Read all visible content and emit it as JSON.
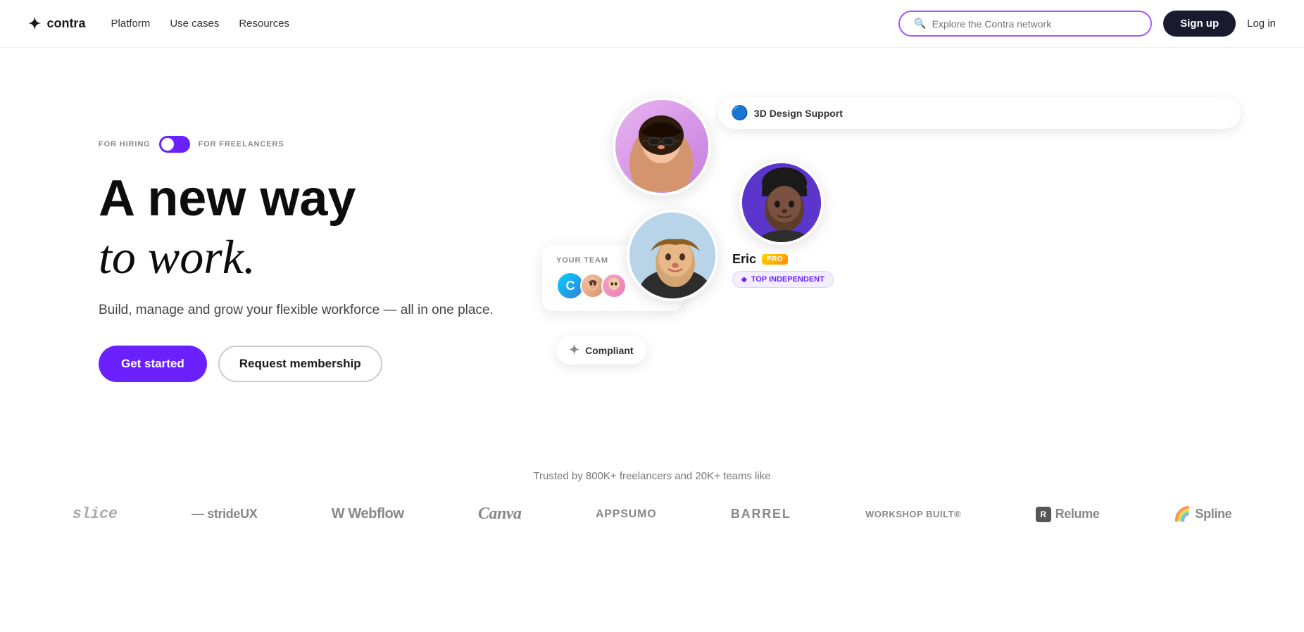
{
  "nav": {
    "logo_text": "contra",
    "links": [
      "Platform",
      "Use cases",
      "Resources"
    ],
    "search_placeholder": "Explore the Contra network",
    "signup_label": "Sign up",
    "login_label": "Log in"
  },
  "hero": {
    "toggle_left": "FOR HIRING",
    "toggle_right": "FOR FREELANCERS",
    "title_line1": "A new way",
    "title_line2": "to work.",
    "description": "Build, manage and grow your flexible workforce — all in one place.",
    "btn_get_started": "Get started",
    "btn_request": "Request membership"
  },
  "floating": {
    "design_badge": "3D Design Support",
    "your_team_label": "YOUR TEAM",
    "compliant_label": "Compliant",
    "eric_name": "Eric",
    "pro_label": "PRO",
    "top_independent": "TOP INDEPENDENT"
  },
  "trusted": {
    "text": "Trusted by 800K+ freelancers and 20K+ teams like",
    "logos": [
      "slice",
      "strideUX",
      "Webflow",
      "Canva",
      "APPSUMO",
      "BARREL",
      "WORKSHOP BUILT®",
      "Relume",
      "Spline"
    ]
  }
}
